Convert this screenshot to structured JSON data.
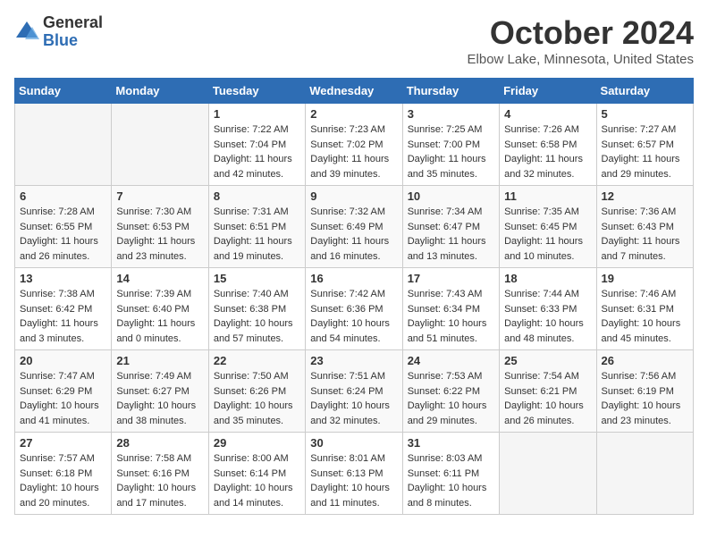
{
  "header": {
    "logo_general": "General",
    "logo_blue": "Blue",
    "title": "October 2024",
    "location": "Elbow Lake, Minnesota, United States"
  },
  "weekdays": [
    "Sunday",
    "Monday",
    "Tuesday",
    "Wednesday",
    "Thursday",
    "Friday",
    "Saturday"
  ],
  "weeks": [
    [
      {
        "day": "",
        "empty": true
      },
      {
        "day": "",
        "empty": true
      },
      {
        "day": "1",
        "sunrise": "Sunrise: 7:22 AM",
        "sunset": "Sunset: 7:04 PM",
        "daylight": "Daylight: 11 hours and 42 minutes."
      },
      {
        "day": "2",
        "sunrise": "Sunrise: 7:23 AM",
        "sunset": "Sunset: 7:02 PM",
        "daylight": "Daylight: 11 hours and 39 minutes."
      },
      {
        "day": "3",
        "sunrise": "Sunrise: 7:25 AM",
        "sunset": "Sunset: 7:00 PM",
        "daylight": "Daylight: 11 hours and 35 minutes."
      },
      {
        "day": "4",
        "sunrise": "Sunrise: 7:26 AM",
        "sunset": "Sunset: 6:58 PM",
        "daylight": "Daylight: 11 hours and 32 minutes."
      },
      {
        "day": "5",
        "sunrise": "Sunrise: 7:27 AM",
        "sunset": "Sunset: 6:57 PM",
        "daylight": "Daylight: 11 hours and 29 minutes."
      }
    ],
    [
      {
        "day": "6",
        "sunrise": "Sunrise: 7:28 AM",
        "sunset": "Sunset: 6:55 PM",
        "daylight": "Daylight: 11 hours and 26 minutes."
      },
      {
        "day": "7",
        "sunrise": "Sunrise: 7:30 AM",
        "sunset": "Sunset: 6:53 PM",
        "daylight": "Daylight: 11 hours and 23 minutes."
      },
      {
        "day": "8",
        "sunrise": "Sunrise: 7:31 AM",
        "sunset": "Sunset: 6:51 PM",
        "daylight": "Daylight: 11 hours and 19 minutes."
      },
      {
        "day": "9",
        "sunrise": "Sunrise: 7:32 AM",
        "sunset": "Sunset: 6:49 PM",
        "daylight": "Daylight: 11 hours and 16 minutes."
      },
      {
        "day": "10",
        "sunrise": "Sunrise: 7:34 AM",
        "sunset": "Sunset: 6:47 PM",
        "daylight": "Daylight: 11 hours and 13 minutes."
      },
      {
        "day": "11",
        "sunrise": "Sunrise: 7:35 AM",
        "sunset": "Sunset: 6:45 PM",
        "daylight": "Daylight: 11 hours and 10 minutes."
      },
      {
        "day": "12",
        "sunrise": "Sunrise: 7:36 AM",
        "sunset": "Sunset: 6:43 PM",
        "daylight": "Daylight: 11 hours and 7 minutes."
      }
    ],
    [
      {
        "day": "13",
        "sunrise": "Sunrise: 7:38 AM",
        "sunset": "Sunset: 6:42 PM",
        "daylight": "Daylight: 11 hours and 3 minutes."
      },
      {
        "day": "14",
        "sunrise": "Sunrise: 7:39 AM",
        "sunset": "Sunset: 6:40 PM",
        "daylight": "Daylight: 11 hours and 0 minutes."
      },
      {
        "day": "15",
        "sunrise": "Sunrise: 7:40 AM",
        "sunset": "Sunset: 6:38 PM",
        "daylight": "Daylight: 10 hours and 57 minutes."
      },
      {
        "day": "16",
        "sunrise": "Sunrise: 7:42 AM",
        "sunset": "Sunset: 6:36 PM",
        "daylight": "Daylight: 10 hours and 54 minutes."
      },
      {
        "day": "17",
        "sunrise": "Sunrise: 7:43 AM",
        "sunset": "Sunset: 6:34 PM",
        "daylight": "Daylight: 10 hours and 51 minutes."
      },
      {
        "day": "18",
        "sunrise": "Sunrise: 7:44 AM",
        "sunset": "Sunset: 6:33 PM",
        "daylight": "Daylight: 10 hours and 48 minutes."
      },
      {
        "day": "19",
        "sunrise": "Sunrise: 7:46 AM",
        "sunset": "Sunset: 6:31 PM",
        "daylight": "Daylight: 10 hours and 45 minutes."
      }
    ],
    [
      {
        "day": "20",
        "sunrise": "Sunrise: 7:47 AM",
        "sunset": "Sunset: 6:29 PM",
        "daylight": "Daylight: 10 hours and 41 minutes."
      },
      {
        "day": "21",
        "sunrise": "Sunrise: 7:49 AM",
        "sunset": "Sunset: 6:27 PM",
        "daylight": "Daylight: 10 hours and 38 minutes."
      },
      {
        "day": "22",
        "sunrise": "Sunrise: 7:50 AM",
        "sunset": "Sunset: 6:26 PM",
        "daylight": "Daylight: 10 hours and 35 minutes."
      },
      {
        "day": "23",
        "sunrise": "Sunrise: 7:51 AM",
        "sunset": "Sunset: 6:24 PM",
        "daylight": "Daylight: 10 hours and 32 minutes."
      },
      {
        "day": "24",
        "sunrise": "Sunrise: 7:53 AM",
        "sunset": "Sunset: 6:22 PM",
        "daylight": "Daylight: 10 hours and 29 minutes."
      },
      {
        "day": "25",
        "sunrise": "Sunrise: 7:54 AM",
        "sunset": "Sunset: 6:21 PM",
        "daylight": "Daylight: 10 hours and 26 minutes."
      },
      {
        "day": "26",
        "sunrise": "Sunrise: 7:56 AM",
        "sunset": "Sunset: 6:19 PM",
        "daylight": "Daylight: 10 hours and 23 minutes."
      }
    ],
    [
      {
        "day": "27",
        "sunrise": "Sunrise: 7:57 AM",
        "sunset": "Sunset: 6:18 PM",
        "daylight": "Daylight: 10 hours and 20 minutes."
      },
      {
        "day": "28",
        "sunrise": "Sunrise: 7:58 AM",
        "sunset": "Sunset: 6:16 PM",
        "daylight": "Daylight: 10 hours and 17 minutes."
      },
      {
        "day": "29",
        "sunrise": "Sunrise: 8:00 AM",
        "sunset": "Sunset: 6:14 PM",
        "daylight": "Daylight: 10 hours and 14 minutes."
      },
      {
        "day": "30",
        "sunrise": "Sunrise: 8:01 AM",
        "sunset": "Sunset: 6:13 PM",
        "daylight": "Daylight: 10 hours and 11 minutes."
      },
      {
        "day": "31",
        "sunrise": "Sunrise: 8:03 AM",
        "sunset": "Sunset: 6:11 PM",
        "daylight": "Daylight: 10 hours and 8 minutes."
      },
      {
        "day": "",
        "empty": true
      },
      {
        "day": "",
        "empty": true
      }
    ]
  ]
}
